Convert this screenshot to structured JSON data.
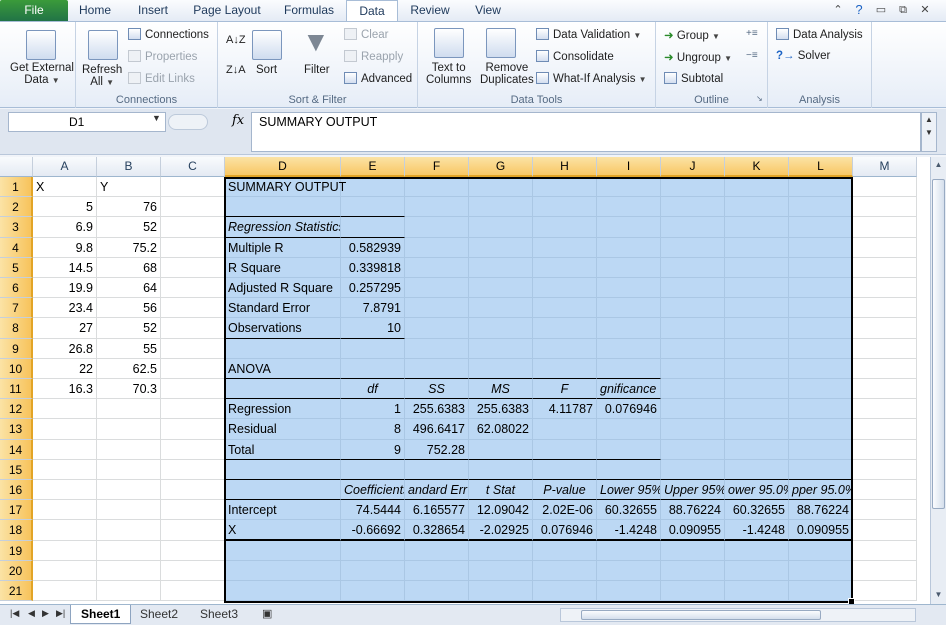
{
  "tabs": [
    {
      "label": "File"
    },
    {
      "label": "Home"
    },
    {
      "label": "Insert"
    },
    {
      "label": "Page Layout"
    },
    {
      "label": "Formulas"
    },
    {
      "label": "Data"
    },
    {
      "label": "Review"
    },
    {
      "label": "View"
    }
  ],
  "ribbon": {
    "get_external": {
      "line1": "Get External",
      "line2": "Data"
    },
    "refresh": {
      "line1": "Refresh",
      "line2": "All"
    },
    "connections": "Connections",
    "properties": "Properties",
    "edit_links": "Edit Links",
    "connections_group": "Connections",
    "sort": "Sort",
    "filter": "Filter",
    "clear": "Clear",
    "reapply": "Reapply",
    "advanced": "Advanced",
    "sort_filter_group": "Sort & Filter",
    "text_to_columns": {
      "line1": "Text to",
      "line2": "Columns"
    },
    "remove_duplicates": {
      "line1": "Remove",
      "line2": "Duplicates"
    },
    "data_validation": "Data Validation",
    "consolidate": "Consolidate",
    "what_if": "What-If Analysis",
    "data_tools_group": "Data Tools",
    "group": "Group",
    "ungroup": "Ungroup",
    "subtotal": "Subtotal",
    "outline_group": "Outline",
    "data_analysis": "Data Analysis",
    "solver": "Solver",
    "analysis_group": "Analysis"
  },
  "formula_bar": {
    "name_box": "D1",
    "fx": "fx",
    "content": "SUMMARY OUTPUT"
  },
  "columns": [
    "A",
    "B",
    "C",
    "D",
    "E",
    "F",
    "G",
    "H",
    "I",
    "J",
    "K",
    "L",
    "M"
  ],
  "rows": [
    "1",
    "2",
    "3",
    "4",
    "5",
    "6",
    "7",
    "8",
    "9",
    "10",
    "11",
    "12",
    "13",
    "14",
    "15",
    "16",
    "17",
    "18",
    "19",
    "20",
    "21"
  ],
  "cells": {
    "A1": "X",
    "B1": "Y",
    "A2": "5",
    "B2": "76",
    "A3": "6.9",
    "B3": "52",
    "A4": "9.8",
    "B4": "75.2",
    "A5": "14.5",
    "B5": "68",
    "A6": "19.9",
    "B6": "64",
    "A7": "23.4",
    "B7": "56",
    "A8": "27",
    "B8": "52",
    "A9": "26.8",
    "B9": "55",
    "A10": "22",
    "B10": "62.5",
    "A11": "16.3",
    "B11": "70.3",
    "D1": "SUMMARY OUTPUT",
    "D3": "Regression Statistics",
    "D4": "Multiple R",
    "E4": "0.582939",
    "D5": "R Square",
    "E5": "0.339818",
    "D6": "Adjusted R Square",
    "E6": "0.257295",
    "D7": "Standard Error",
    "E7": "7.8791",
    "D8": "Observations",
    "E8": "10",
    "D10": "ANOVA",
    "E11": "df",
    "F11": "SS",
    "G11": "MS",
    "H11": "F",
    "I11": "gnificance F",
    "D12": "Regression",
    "E12": "1",
    "F12": "255.6383",
    "G12": "255.6383",
    "H12": "4.11787",
    "I12": "0.076946",
    "D13": "Residual",
    "E13": "8",
    "F13": "496.6417",
    "G13": "62.08022",
    "D14": "Total",
    "E14": "9",
    "F14": "752.28",
    "E16": "Coefficients",
    "F16": "andard Err",
    "G16": "t Stat",
    "H16": "P-value",
    "I16": "Lower 95%",
    "J16": "Upper 95%",
    "K16": "ower 95.0%",
    "L16": "pper 95.0%",
    "D17": "Intercept",
    "E17": "74.5444",
    "F17": "6.165577",
    "G17": "12.09042",
    "H17": "2.02E-06",
    "I17": "60.32655",
    "J17": "88.76224",
    "K17": "60.32655",
    "L17": "88.76224",
    "D18": "X",
    "E18": "-0.66692",
    "F18": "0.328654",
    "G18": "-2.02925",
    "H18": "0.076946",
    "I18": "-1.4248",
    "J18": "0.090955",
    "K18": "-1.4248",
    "L18": "0.090955"
  },
  "sheets": [
    "Sheet1",
    "Sheet2",
    "Sheet3"
  ],
  "active_sheet": "Sheet1",
  "colors": {
    "selection": "#bcd8f4",
    "header_selected": "#f8c765",
    "file_tab": "#217346"
  }
}
